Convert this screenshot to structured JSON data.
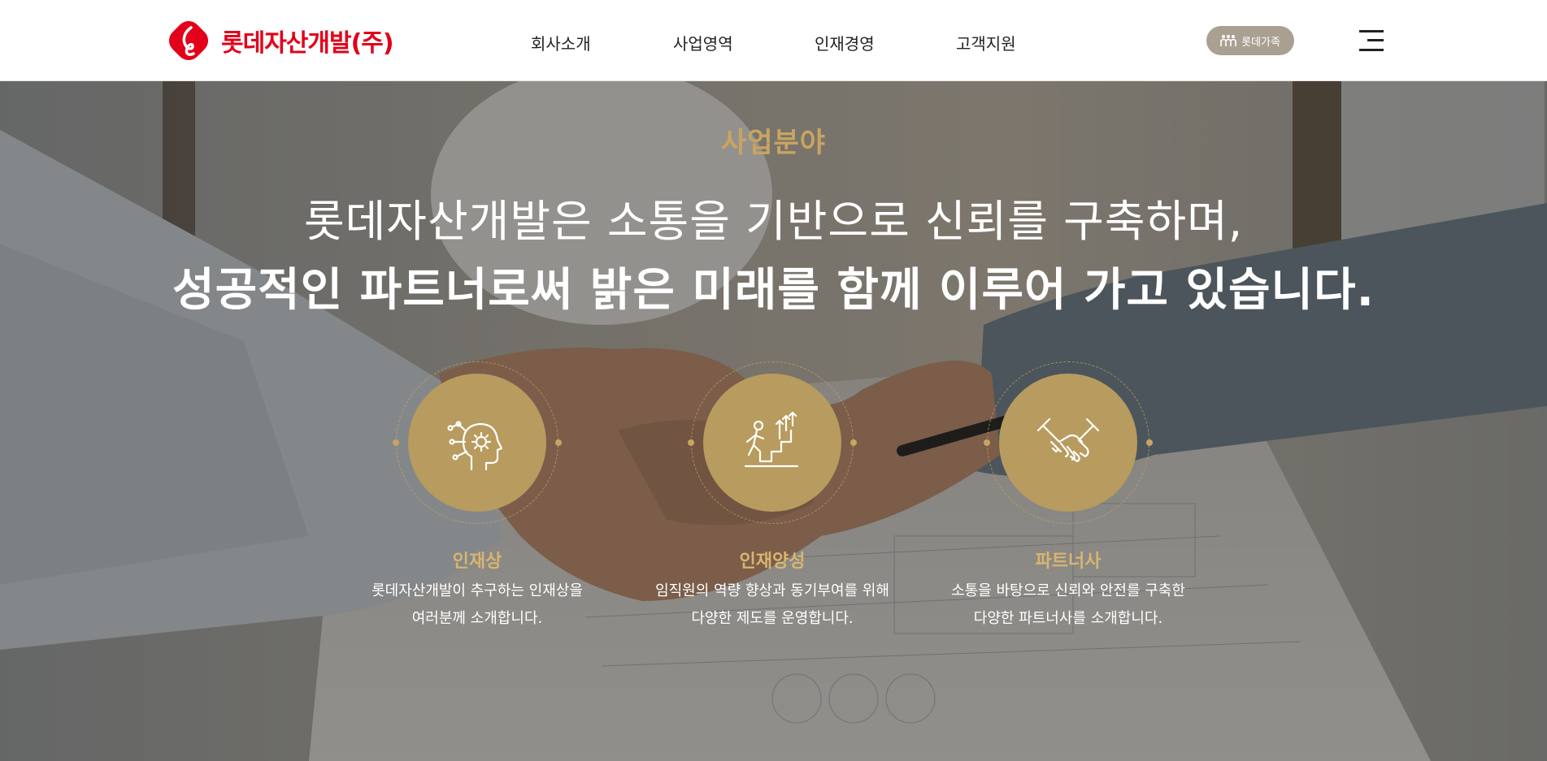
{
  "header": {
    "logo_text": "롯데자산개발(주)",
    "nav": [
      {
        "label": "회사소개"
      },
      {
        "label": "사업영역"
      },
      {
        "label": "인재경영"
      },
      {
        "label": "고객지원"
      }
    ],
    "family_button": "롯데가족",
    "menu_icon": "hamburger-icon"
  },
  "hero": {
    "eyebrow": "사업분야",
    "line1": "롯데자산개발은 소통을 기반으로 신뢰를 구축하며,",
    "line2": "성공적인 파트너로써 밝은 미래를 함께 이루어 가고 있습니다.",
    "features": [
      {
        "icon": "head-gear-icon",
        "title": "인재상",
        "desc_line1": "롯데자산개발이 추구하는 인재상을",
        "desc_line2": "여러분께 소개합니다."
      },
      {
        "icon": "person-climbing-stairs-icon",
        "title": "인재양성",
        "desc_line1": "임직원의 역량 향상과 동기부여를 위해",
        "desc_line2": "다양한 제도를 운영합니다."
      },
      {
        "icon": "handshake-icon",
        "title": "파트너사",
        "desc_line1": "소통을 바탕으로 신뢰와 안전를 구축한",
        "desc_line2": "다양한 파트너사를 소개합니다."
      }
    ]
  },
  "colors": {
    "brand_red": "#e2001a",
    "accent_gold": "#c9a461",
    "disc_gold": "#b89b5e",
    "family_button_bg": "#a9a092"
  }
}
